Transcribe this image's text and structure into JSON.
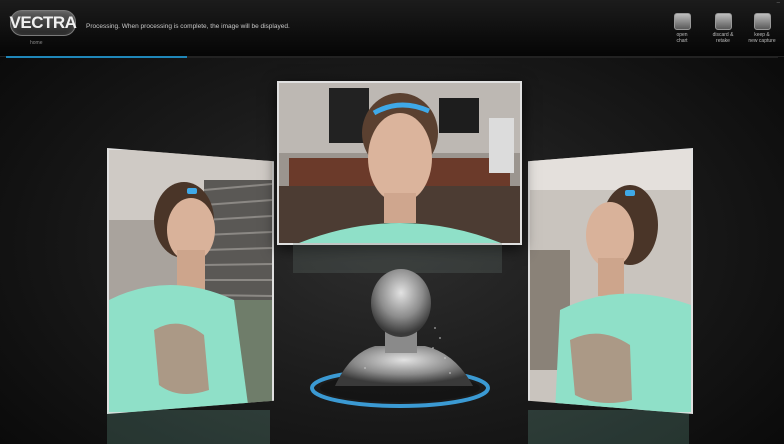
{
  "header": {
    "logo_text": "VECTRA",
    "home_label": "home",
    "status": "Processing. When processing is complete, the image will be displayed.",
    "progress_fraction": 0.235,
    "minimize_glyph": "–"
  },
  "toolbar": {
    "open_chart": {
      "line1": "open",
      "line2": "chart",
      "icon": "chart-icon"
    },
    "discard_retake": {
      "line1": "discard &",
      "line2": "retake",
      "icon": "trash-icon"
    },
    "keep_new_capture": {
      "line1": "keep &",
      "line2": "new capture",
      "icon": "camera-icon"
    }
  },
  "colors": {
    "accent": "#1f86b8",
    "turntable_ring": "#3fa9e8",
    "shirt": "#8fe0c8",
    "skin": "#d9b29a"
  }
}
